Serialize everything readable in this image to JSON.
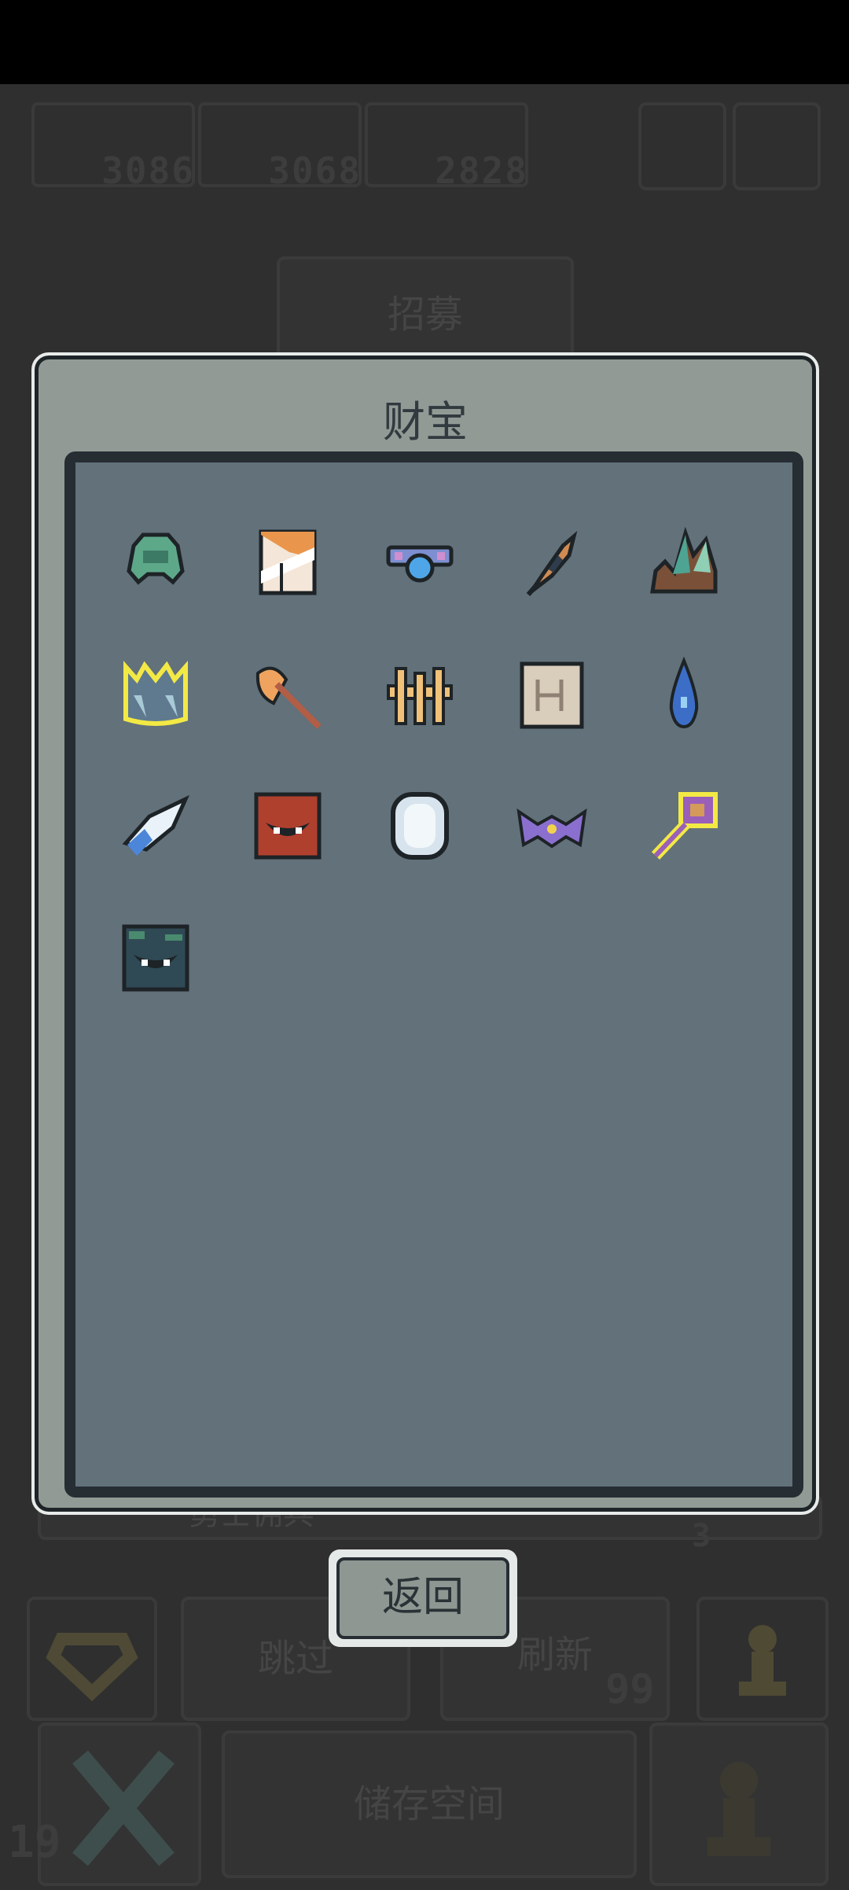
{
  "background": {
    "resources": [
      "3086",
      "3068",
      "2828"
    ],
    "recruit_tab": "招募",
    "skip_button": "跳过",
    "refresh_button": "刷新",
    "refresh_cost": "99",
    "badge_number": "3",
    "lower_left_number": "19",
    "bottom_center_text": "储存空间",
    "hidden_bar_text": "勇士佣兵"
  },
  "treasure_dialog": {
    "title": "财宝",
    "items": [
      {
        "name": "green-helmet-icon",
        "highlight": false
      },
      {
        "name": "striped-scroll-icon",
        "highlight": false
      },
      {
        "name": "blue-orb-amulet-icon",
        "highlight": false
      },
      {
        "name": "feather-dagger-icon",
        "highlight": false
      },
      {
        "name": "crystal-rock-icon",
        "highlight": false
      },
      {
        "name": "spiked-crown-icon",
        "highlight": true
      },
      {
        "name": "axe-icon",
        "highlight": false
      },
      {
        "name": "golden-trident-icon",
        "highlight": false
      },
      {
        "name": "parchment-map-icon",
        "highlight": false
      },
      {
        "name": "water-drop-icon",
        "highlight": false
      },
      {
        "name": "blue-gem-dagger-icon",
        "highlight": false
      },
      {
        "name": "red-brick-monster-icon",
        "highlight": false
      },
      {
        "name": "silver-mirror-icon",
        "highlight": false
      },
      {
        "name": "purple-bat-icon",
        "highlight": false
      },
      {
        "name": "purple-key-icon",
        "highlight": true
      },
      {
        "name": "mossy-stone-monster-icon",
        "highlight": false
      }
    ],
    "back_button": "返回"
  }
}
